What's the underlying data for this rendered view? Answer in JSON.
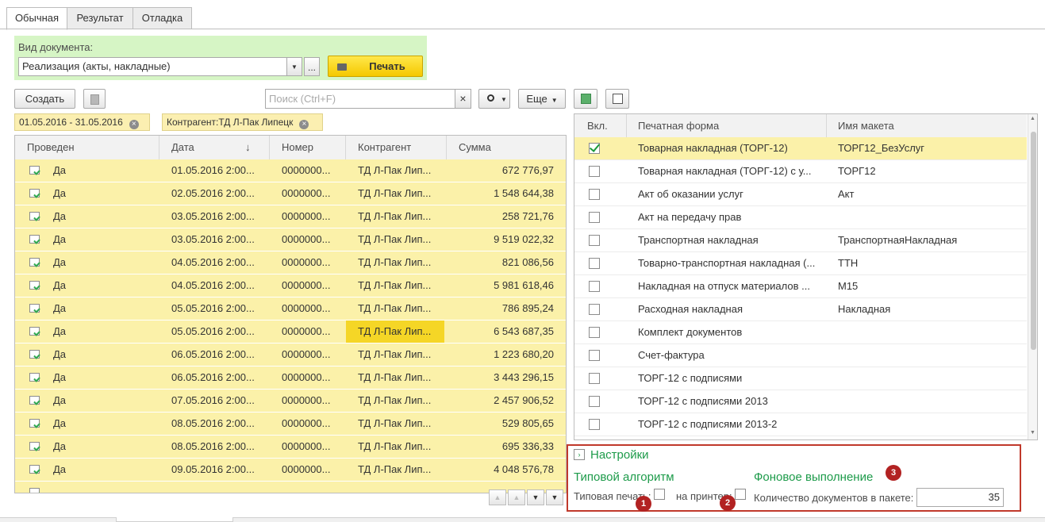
{
  "tabs": [
    {
      "label": "Обычная",
      "active": true
    },
    {
      "label": "Результат",
      "active": false
    },
    {
      "label": "Отладка",
      "active": false
    }
  ],
  "doc_kind": {
    "label": "Вид документа:",
    "value": "Реализация (акты, накладные)",
    "ellipsis": "...",
    "print_label": "Печать"
  },
  "toolbar": {
    "create_label": "Создать",
    "search_placeholder": "Поиск (Ctrl+F)",
    "more_label": "Еще",
    "clear_glyph": "×"
  },
  "filters": [
    {
      "text": "01.05.2016 - 31.05.2016"
    },
    {
      "text": "Контрагент:ТД Л-Пак Липецк"
    }
  ],
  "documents": {
    "columns": [
      "Проведен",
      "Дата",
      "Номер",
      "Контрагент",
      "Сумма"
    ],
    "sort_indicator": "↓",
    "rows": [
      {
        "posted": "Да",
        "date": "01.05.2016 2:00...",
        "number": "0000000...",
        "counterparty": "ТД Л-Пак Лип...",
        "sum": "672 776,97"
      },
      {
        "posted": "Да",
        "date": "02.05.2016 2:00...",
        "number": "0000000...",
        "counterparty": "ТД Л-Пак Лип...",
        "sum": "1 548 644,38"
      },
      {
        "posted": "Да",
        "date": "03.05.2016 2:00...",
        "number": "0000000...",
        "counterparty": "ТД Л-Пак Лип...",
        "sum": "258 721,76"
      },
      {
        "posted": "Да",
        "date": "03.05.2016 2:00...",
        "number": "0000000...",
        "counterparty": "ТД Л-Пак Лип...",
        "sum": "9 519 022,32"
      },
      {
        "posted": "Да",
        "date": "04.05.2016 2:00...",
        "number": "0000000...",
        "counterparty": "ТД Л-Пак Лип...",
        "sum": "821 086,56"
      },
      {
        "posted": "Да",
        "date": "04.05.2016 2:00...",
        "number": "0000000...",
        "counterparty": "ТД Л-Пак Лип...",
        "sum": "5 981 618,46"
      },
      {
        "posted": "Да",
        "date": "05.05.2016 2:00...",
        "number": "0000000...",
        "counterparty": "ТД Л-Пак Лип...",
        "sum": "786 895,24"
      },
      {
        "posted": "Да",
        "date": "05.05.2016 2:00...",
        "number": "0000000...",
        "counterparty": "ТД Л-Пак Лип...",
        "sum": "6 543 687,35",
        "highlight": true
      },
      {
        "posted": "Да",
        "date": "06.05.2016 2:00...",
        "number": "0000000...",
        "counterparty": "ТД Л-Пак Лип...",
        "sum": "1 223 680,20"
      },
      {
        "posted": "Да",
        "date": "06.05.2016 2:00...",
        "number": "0000000...",
        "counterparty": "ТД Л-Пак Лип...",
        "sum": "3 443 296,15"
      },
      {
        "posted": "Да",
        "date": "07.05.2016 2:00...",
        "number": "0000000...",
        "counterparty": "ТД Л-Пак Лип...",
        "sum": "2 457 906,52"
      },
      {
        "posted": "Да",
        "date": "08.05.2016 2:00...",
        "number": "0000000...",
        "counterparty": "ТД Л-Пак Лип...",
        "sum": "529 805,65"
      },
      {
        "posted": "Да",
        "date": "08.05.2016 2:00...",
        "number": "0000000...",
        "counterparty": "ТД Л-Пак Лип...",
        "sum": "695 336,33"
      },
      {
        "posted": "Да",
        "date": "09.05.2016 2:00...",
        "number": "0000000...",
        "counterparty": "ТД Л-Пак Лип...",
        "sum": "4 048 576,78"
      }
    ]
  },
  "print_forms": {
    "columns": [
      "Вкл.",
      "Печатная форма",
      "Имя макета"
    ],
    "rows": [
      {
        "checked": true,
        "form": "Товарная накладная (ТОРГ-12)",
        "template": "ТОРГ12_БезУслуг",
        "selected": true
      },
      {
        "checked": false,
        "form": "Товарная накладная (ТОРГ-12) с у...",
        "template": "ТОРГ12"
      },
      {
        "checked": false,
        "form": "Акт об оказании услуг",
        "template": "Акт"
      },
      {
        "checked": false,
        "form": "Акт на передачу прав",
        "template": ""
      },
      {
        "checked": false,
        "form": "Транспортная накладная",
        "template": "ТранспортнаяНакладная"
      },
      {
        "checked": false,
        "form": "Товарно-транспортная накладная (...",
        "template": "ТТН"
      },
      {
        "checked": false,
        "form": "Накладная на отпуск материалов ...",
        "template": "М15"
      },
      {
        "checked": false,
        "form": "Расходная накладная",
        "template": "Накладная"
      },
      {
        "checked": false,
        "form": "Комплект документов",
        "template": ""
      },
      {
        "checked": false,
        "form": "Счет-фактура",
        "template": ""
      },
      {
        "checked": false,
        "form": "ТОРГ-12 с подписями",
        "template": ""
      },
      {
        "checked": false,
        "form": "ТОРГ-12 с подписями 2013",
        "template": ""
      },
      {
        "checked": false,
        "form": "ТОРГ-12 с подписями 2013-2",
        "template": ""
      }
    ]
  },
  "settings": {
    "title": "Настройки",
    "typical_heading": "Типовой алгоритм",
    "typical_print_label": "Типовая печать:",
    "printer_label": "на принтер:",
    "background_heading": "Фоновое выполнение",
    "batch_label": "Количество документов в пакете:",
    "batch_value": "35",
    "badges": [
      "1",
      "2",
      "3"
    ]
  },
  "colors": {
    "accent_green": "#1d9b4a",
    "row_yellow": "#fbf1a9",
    "highlight_yellow": "#f5d626",
    "annotation_red": "#c0392b"
  }
}
